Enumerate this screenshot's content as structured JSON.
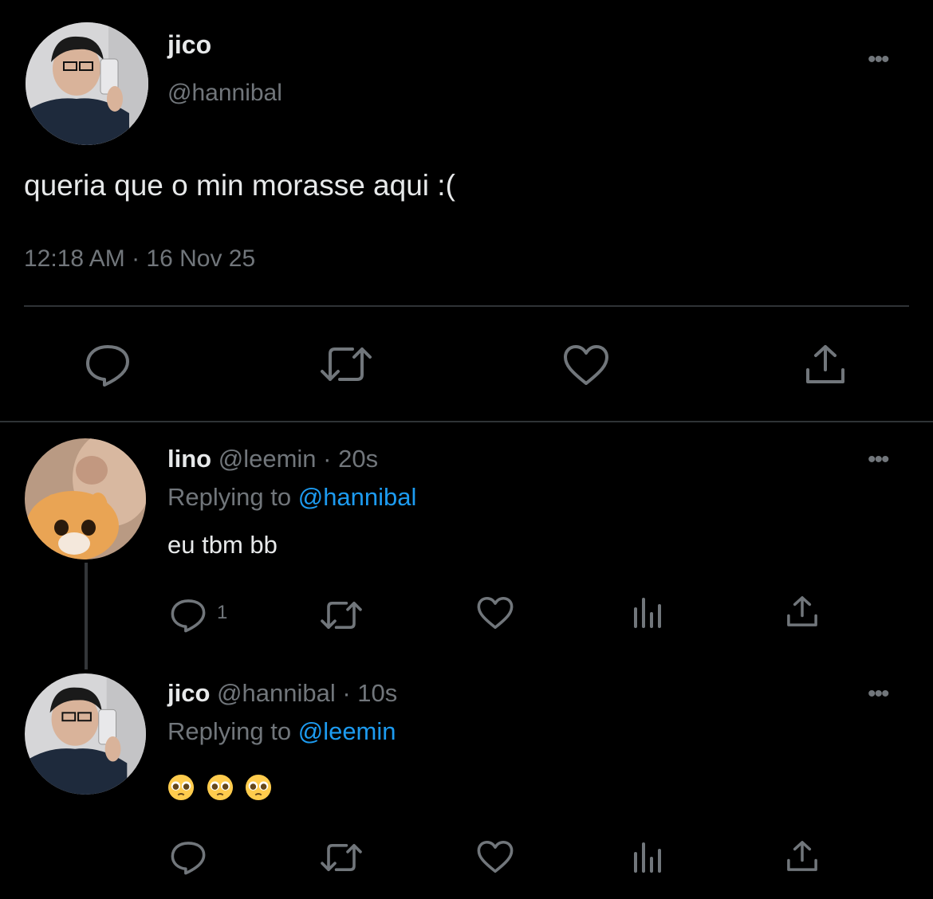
{
  "main_tweet": {
    "author_name": "jico",
    "author_handle": "@hannibal",
    "text": "queria que o min morasse aqui :(",
    "timestamp": "12:18 AM · 16 Nov 25",
    "more_label": "•••"
  },
  "replies": [
    {
      "author_name": "lino",
      "author_handle": "@leemin",
      "time": "· 20s",
      "replying_prefix": "Replying to",
      "replying_to": "@hannibal",
      "text": "eu tbm bb",
      "reply_count": "1",
      "more_label": "•••"
    },
    {
      "author_name": "jico",
      "author_handle": "@hannibal",
      "time": "· 10s",
      "replying_prefix": "Replying to",
      "replying_to": "@leemin",
      "text": "🥺🥺🥺",
      "more_label": "•••"
    }
  ],
  "colors": {
    "background": "#000000",
    "text_primary": "#e7e9ea",
    "text_secondary": "#71767b",
    "link": "#1d9bf0",
    "divider": "#2f3336"
  },
  "icons": [
    "reply-icon",
    "retweet-icon",
    "like-icon",
    "share-icon",
    "views-icon",
    "more-icon"
  ]
}
